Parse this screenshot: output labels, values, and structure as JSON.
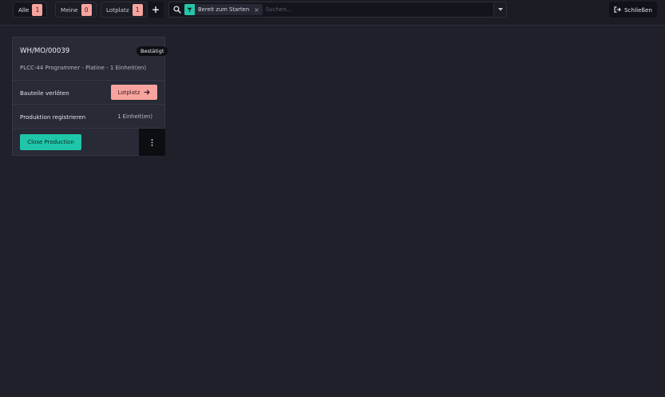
{
  "topbar": {
    "tabs": [
      {
        "label": "Alle",
        "count": "1"
      },
      {
        "label": "Meine",
        "count": "0"
      },
      {
        "label": "Lotplatz",
        "count": "1"
      }
    ],
    "add_label": "+",
    "search": {
      "facet_label": "Bereit zum Starten",
      "facet_remove": "×",
      "placeholder": "Suchen..."
    },
    "close_label": "Schließen"
  },
  "card": {
    "reference": "WH/MO/00039",
    "state": "Bestätigt",
    "product_line": "PLCC-44 Programmer - Platine - 1 Einheit(en)",
    "step1_label": "Bauteile verlöten",
    "step1_button": "Lotplatz",
    "step2_label": "Produktion registrieren",
    "step2_qty": "1 Einheit(en)",
    "close_production": "Close Production"
  },
  "colors": {
    "background": "#1f2029",
    "accent_primary": "#1fc6a9",
    "accent_secondary": "#f7a49f"
  }
}
